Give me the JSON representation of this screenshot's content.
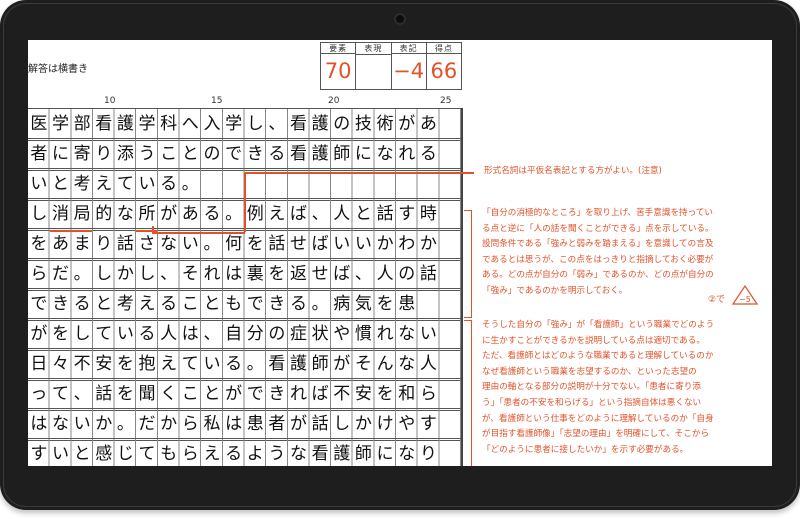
{
  "header": {
    "instruction": "解答は横書き",
    "score": [
      {
        "label": "要素",
        "value": "70"
      },
      {
        "label": "表現",
        "value": ""
      },
      {
        "label": "表記",
        "value": "−4"
      },
      {
        "label": "得点",
        "value": "66"
      }
    ]
  },
  "column_numbers": [
    "10",
    "15",
    "20",
    "25"
  ],
  "rows": [
    "医学部看護学科へ入学し、看護の技術があ",
    "者に寄り添うことのできる看護師になれる",
    "いと考えている。",
    "し消局的な所がある。例えば、人と話す時",
    "をあまり話さない。何を話せばいいかわか",
    "らだ。しかし、それは裏を返せば、人の話",
    "できると考えることもできる。病気を患",
    "がをしている人は、自分の症状や慣れない",
    "日々不安を抱えている。看護師がそんな人",
    "って、話を聞くことができれば不安を和ら",
    "はないか。だから私は患者が話しかけやす",
    "すいと感じてもらえるような看護師になり"
  ],
  "annotations": {
    "note1": "形式名詞は平仮名表記とする方がよい。(注意)",
    "note2": [
      "「自分の消極的なところ」を取り上げ、苦手意識を持ってい",
      "る点と逆に「人の話を聞くことができる」点を示している。",
      "設問条件である「強みと弱みを踏まえる」を意識しての言及",
      "であるとは思うが、この点をはっきりと指摘しておく必要が",
      "ある。どの点が自分の「弱み」であるのか、どの点が自分の",
      "「強み」であるのかを明示しておく。"
    ],
    "badge_circle": "②で",
    "badge_tri": "−5",
    "note3": [
      "そうした自分の「強み」が「看護師」という職業でどのよう",
      "に生かすことができるかを説明している点は適切である。",
      "ただ、看護師とはどのような職業であると理解しているのか",
      "なぜ看護師という職業を志望するのか、といった志望の",
      "理由の軸となる部分の説明が十分でない。「患者に寄り添",
      "う」「患者の不安を和らげる」という指摘自体は悪くない",
      "が、看護師という仕事をどのように理解しているのか「自身",
      "が目指す看護師像」「志望の理由」を明確にして、そこから",
      "「どのように患者に接したいか」を示す必要がある。"
    ]
  },
  "colors": {
    "accent": "#e2522a",
    "frame": "#1e1e1e"
  }
}
